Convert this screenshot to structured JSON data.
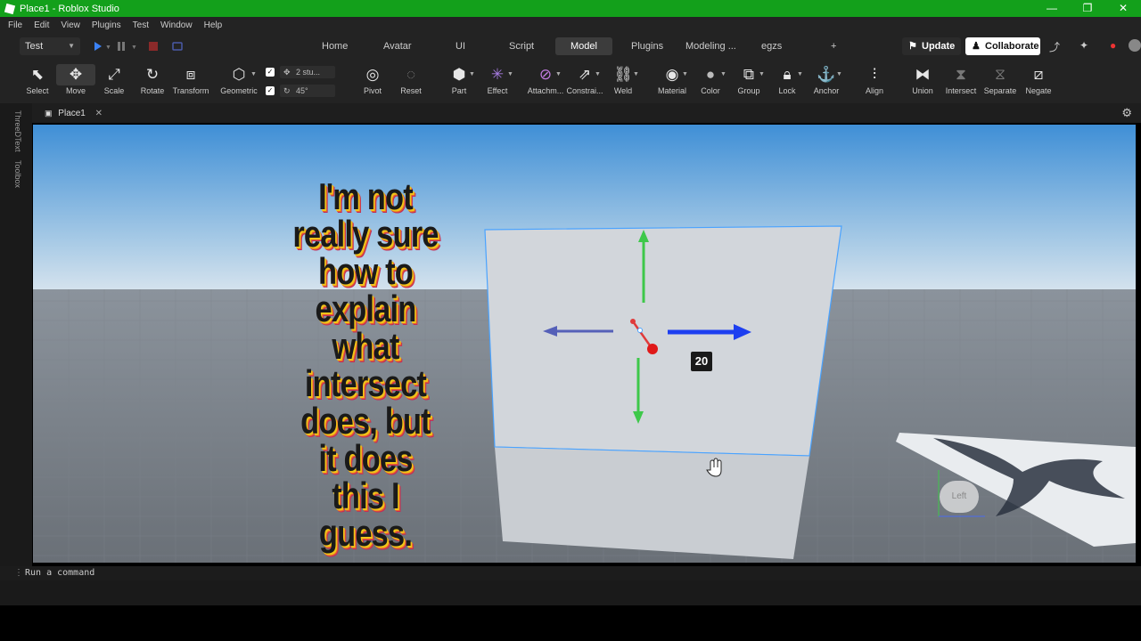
{
  "window": {
    "title": "Place1 - Roblox Studio",
    "controls": [
      "—",
      "❐",
      "✕"
    ]
  },
  "menu": [
    "File",
    "Edit",
    "View",
    "Plugins",
    "Test",
    "Window",
    "Help"
  ],
  "header": {
    "mode": "Test",
    "tabs": [
      "Home",
      "Avatar",
      "UI",
      "Script",
      "Model",
      "Plugins",
      "Modeling ...",
      "egzs",
      "+"
    ],
    "active_tab": "Model",
    "update_label": "Update",
    "collaborate_label": "Collaborate"
  },
  "toolbar": {
    "tools": [
      {
        "label": "Select",
        "icon": "cursor-icon"
      },
      {
        "label": "Move",
        "icon": "move-icon"
      },
      {
        "label": "Scale",
        "icon": "scale-icon"
      },
      {
        "label": "Rotate",
        "icon": "rotate-icon"
      },
      {
        "label": "Transform",
        "icon": "transform-icon"
      },
      {
        "label": "Geometric",
        "icon": "geometric-icon"
      },
      {
        "label": "Pivot",
        "icon": "pivot-icon"
      },
      {
        "label": "Reset",
        "icon": "reset-icon"
      },
      {
        "label": "Part",
        "icon": "cube-icon"
      },
      {
        "label": "Effect",
        "icon": "effect-icon"
      },
      {
        "label": "Attachm...",
        "icon": "attachment-icon"
      },
      {
        "label": "Constrai...",
        "icon": "constraint-icon"
      },
      {
        "label": "Weld",
        "icon": "weld-icon"
      },
      {
        "label": "Material",
        "icon": "material-icon"
      },
      {
        "label": "Color",
        "icon": "color-icon"
      },
      {
        "label": "Group",
        "icon": "group-icon"
      },
      {
        "label": "Lock",
        "icon": "lock-icon"
      },
      {
        "label": "Anchor",
        "icon": "anchor-icon"
      },
      {
        "label": "Align",
        "icon": "align-icon"
      },
      {
        "label": "Union",
        "icon": "union-icon"
      },
      {
        "label": "Intersect",
        "icon": "intersect-icon"
      },
      {
        "label": "Separate",
        "icon": "separate-icon"
      },
      {
        "label": "Negate",
        "icon": "negate-icon"
      }
    ],
    "snap_move": "2 stu...",
    "snap_rotate": "45°"
  },
  "document": {
    "tab": "Place1"
  },
  "side_tabs": [
    "ThreeDText",
    "Toolbox"
  ],
  "viewport": {
    "caption": "I'm not really sure how to explain what intersect does, but it does this I guess.",
    "measure_badge": "20",
    "view_cube_label": "Left"
  },
  "command_bar": {
    "placeholder": "Run a command"
  }
}
